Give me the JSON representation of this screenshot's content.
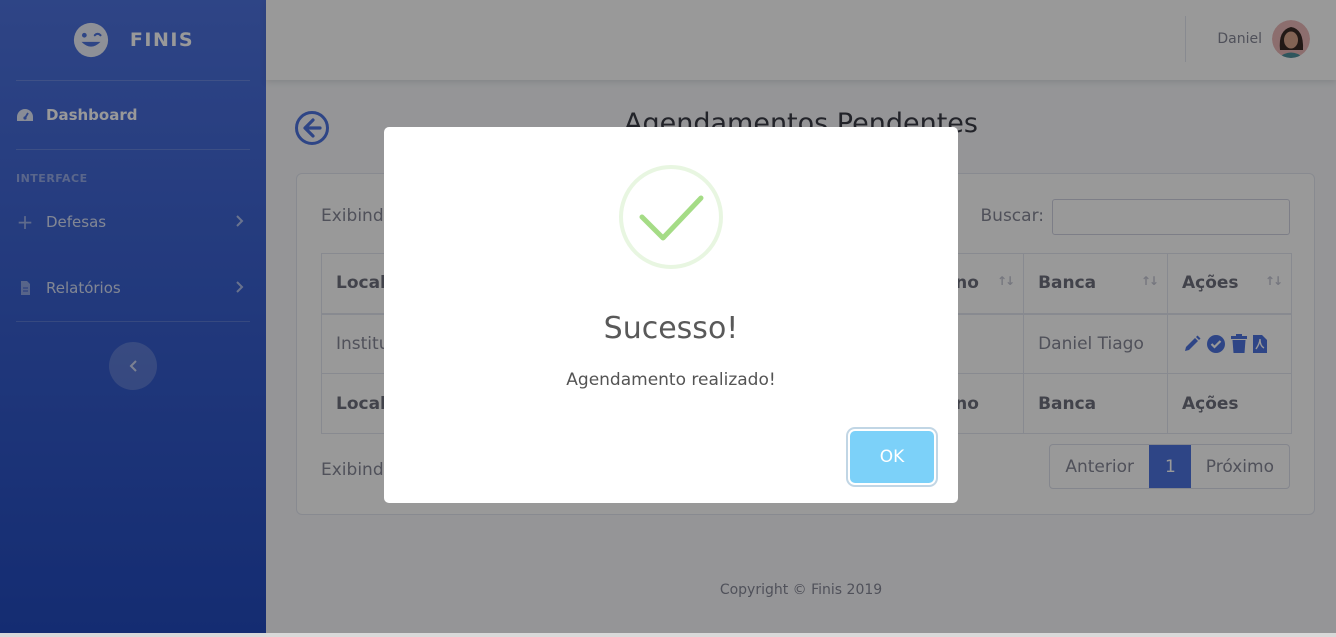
{
  "brand": {
    "name": "FINIS"
  },
  "sidebar": {
    "dashboard_label": "Dashboard",
    "heading": "INTERFACE",
    "items": [
      {
        "label": "Defesas",
        "icon": "plus-icon"
      },
      {
        "label": "Relatórios",
        "icon": "file-icon"
      }
    ],
    "toggle_icon": "chevron-left-icon"
  },
  "topbar": {
    "user_name": "Daniel"
  },
  "page": {
    "title": "Agendamentos Pendentes"
  },
  "table": {
    "show_top": "Exibindo",
    "search_label": "Buscar:",
    "search_value": "",
    "headers": [
      "Local",
      "no",
      "Banca",
      "Ações"
    ],
    "row": {
      "local": "Institu",
      "banca": "Daniel Tiago"
    },
    "footers": [
      "Local",
      "no",
      "Banca",
      "Ações"
    ],
    "show_bottom": "Exibindo",
    "pager": {
      "prev": "Anterior",
      "current": "1",
      "next": "Próximo"
    }
  },
  "footer": {
    "copyright": "Copyright © Finis 2019"
  },
  "modal": {
    "title": "Sucesso!",
    "text": "Agendamento realizado!",
    "ok_label": "OK",
    "icon": "check-success-icon"
  },
  "colors": {
    "primary": "#4e73df",
    "success": "#a5dc86",
    "ok_button": "#7cd1f9"
  }
}
